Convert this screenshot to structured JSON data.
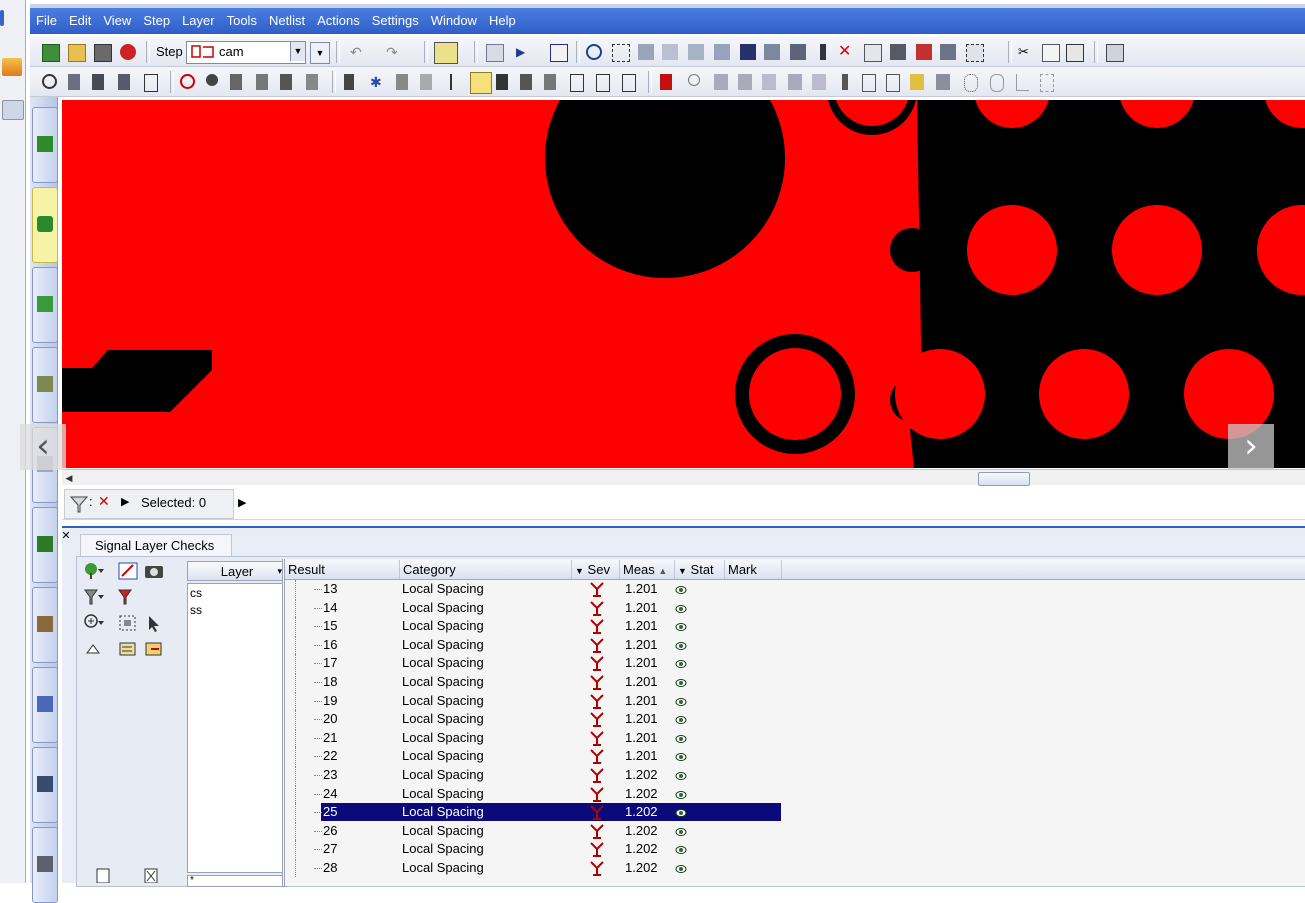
{
  "menubar": {
    "items": [
      "File",
      "Edit",
      "View",
      "Step",
      "Layer",
      "Tools",
      "Netlist",
      "Actions",
      "Settings",
      "Window",
      "Help"
    ]
  },
  "toolbar": {
    "step_label": "Step",
    "step_value": "cam"
  },
  "selection_bar": {
    "selected_text": "Selected: 0"
  },
  "checks_panel": {
    "tab_label": "Signal Layer Checks",
    "layer_header": "Layer",
    "layers": [
      "cs",
      "ss"
    ],
    "filter_value": "*"
  },
  "results_table": {
    "columns": [
      "Result",
      "Category",
      "Sev",
      "Meas",
      "Stat",
      "Mark"
    ],
    "rows": [
      {
        "result": "13",
        "category": "Local Spacing",
        "meas": "1.201",
        "selected": false
      },
      {
        "result": "14",
        "category": "Local Spacing",
        "meas": "1.201",
        "selected": false
      },
      {
        "result": "15",
        "category": "Local Spacing",
        "meas": "1.201",
        "selected": false
      },
      {
        "result": "16",
        "category": "Local Spacing",
        "meas": "1.201",
        "selected": false
      },
      {
        "result": "17",
        "category": "Local Spacing",
        "meas": "1.201",
        "selected": false
      },
      {
        "result": "18",
        "category": "Local Spacing",
        "meas": "1.201",
        "selected": false
      },
      {
        "result": "19",
        "category": "Local Spacing",
        "meas": "1.201",
        "selected": false
      },
      {
        "result": "20",
        "category": "Local Spacing",
        "meas": "1.201",
        "selected": false
      },
      {
        "result": "21",
        "category": "Local Spacing",
        "meas": "1.201",
        "selected": false
      },
      {
        "result": "22",
        "category": "Local Spacing",
        "meas": "1.201",
        "selected": false
      },
      {
        "result": "23",
        "category": "Local Spacing",
        "meas": "1.202",
        "selected": false
      },
      {
        "result": "24",
        "category": "Local Spacing",
        "meas": "1.202",
        "selected": false
      },
      {
        "result": "25",
        "category": "Local Spacing",
        "meas": "1.202",
        "selected": true
      },
      {
        "result": "26",
        "category": "Local Spacing",
        "meas": "1.202",
        "selected": false
      },
      {
        "result": "27",
        "category": "Local Spacing",
        "meas": "1.202",
        "selected": false
      },
      {
        "result": "28",
        "category": "Local Spacing",
        "meas": "1.202",
        "selected": false
      }
    ]
  },
  "colors": {
    "menubar_blue": "#2f5ec8",
    "copper_red": "#ff0000",
    "void_black": "#000000",
    "selection_navy": "#0a0a7a",
    "severity_red": "#b00000"
  },
  "icons": {
    "nav_prev": "‹",
    "nav_next": "›",
    "play": "▶",
    "close": "✕"
  }
}
